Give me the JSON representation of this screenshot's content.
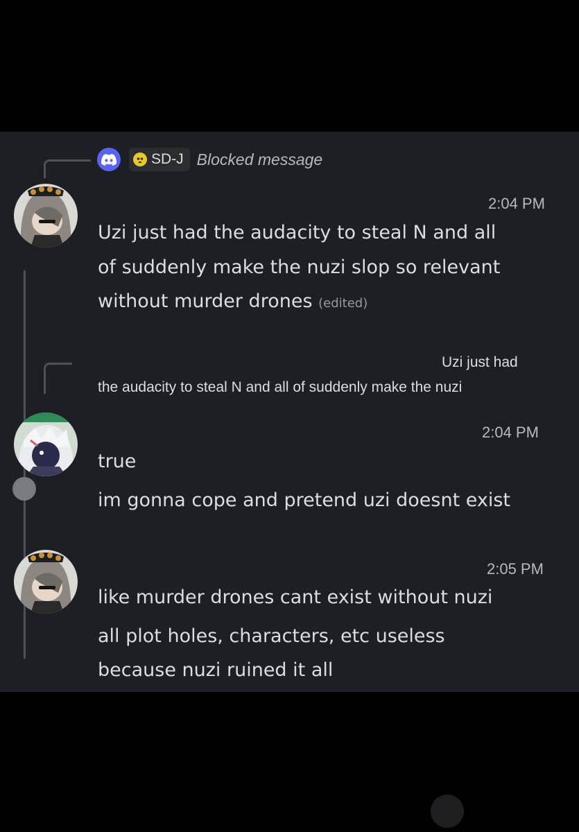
{
  "reply_header": {
    "icon": "discord-icon",
    "username": "SD-J",
    "username_icon": "skull-icon",
    "blocked_text": "Blocked message"
  },
  "messages": [
    {
      "timestamp": "2:04 PM",
      "lines": [
        "Uzi just had the audacity to steal N and all",
        "of suddenly make the nuzi slop so relevant",
        "without murder drones"
      ],
      "edited": "(edited)"
    },
    {
      "quote_lines": [
        "Uzi just had",
        "the audacity to steal N and all of suddenly make the nuzi"
      ]
    },
    {
      "timestamp": "2:04 PM",
      "lines": [
        "true",
        "im gonna cope and pretend uzi doesnt exist"
      ]
    },
    {
      "timestamp": "2:05 PM",
      "lines": [
        "like murder drones cant exist without nuzi",
        "all plot holes, characters, etc useless",
        "because nuzi ruined it all"
      ]
    }
  ],
  "colors": {
    "background": "#1e1f24",
    "text": "#dbdee1",
    "muted": "#b5bac1",
    "discord_blurple": "#5865f2",
    "skull_yellow": "#e8c92c"
  }
}
